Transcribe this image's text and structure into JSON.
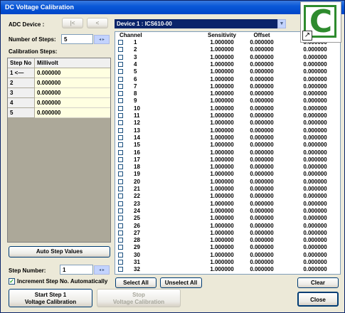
{
  "window": {
    "title": "DC Voltage Calibration"
  },
  "adc": {
    "label": "ADC Device :",
    "first_btn": "|<",
    "prev_btn": "<",
    "device": "Device 1 : ICS610-00"
  },
  "steps": {
    "label": "Number of Steps:",
    "value": "5"
  },
  "calibration": {
    "label": "Calibration Steps:",
    "col_step": "Step No",
    "col_mv": "Millivolt",
    "rows": [
      {
        "step": "1 <—",
        "mv": "0.000000"
      },
      {
        "step": "2",
        "mv": "0.000000"
      },
      {
        "step": "3",
        "mv": "0.000000"
      },
      {
        "step": "4",
        "mv": "0.000000"
      },
      {
        "step": "5",
        "mv": "0.000000"
      }
    ]
  },
  "auto_step": "Auto Step Values",
  "step_number": {
    "label": "Step Number:",
    "value": "1"
  },
  "increment": {
    "label": "Increment Step No. Automatically",
    "checked": true
  },
  "start_btn": {
    "line1": "Start Step 1",
    "line2": "Voltage Calibration"
  },
  "stop_btn": {
    "line1": "Stop",
    "line2": "Voltage Calibration"
  },
  "grid": {
    "col_channel": "Channel",
    "col_sensitivity": "Sensitivity",
    "col_offset": "Offset",
    "rows": [
      {
        "ch": "1",
        "sens": "1.000000",
        "off": "0.000000",
        "gain": "0.000000"
      },
      {
        "ch": "2",
        "sens": "1.000000",
        "off": "0.000000",
        "gain": "0.000000"
      },
      {
        "ch": "3",
        "sens": "1.000000",
        "off": "0.000000",
        "gain": "0.000000"
      },
      {
        "ch": "4",
        "sens": "1.000000",
        "off": "0.000000",
        "gain": "0.000000"
      },
      {
        "ch": "5",
        "sens": "1.000000",
        "off": "0.000000",
        "gain": "0.000000"
      },
      {
        "ch": "6",
        "sens": "1.000000",
        "off": "0.000000",
        "gain": "0.000000"
      },
      {
        "ch": "7",
        "sens": "1.000000",
        "off": "0.000000",
        "gain": "0.000000"
      },
      {
        "ch": "8",
        "sens": "1.000000",
        "off": "0.000000",
        "gain": "0.000000"
      },
      {
        "ch": "9",
        "sens": "1.000000",
        "off": "0.000000",
        "gain": "0.000000"
      },
      {
        "ch": "10",
        "sens": "1.000000",
        "off": "0.000000",
        "gain": "0.000000"
      },
      {
        "ch": "11",
        "sens": "1.000000",
        "off": "0.000000",
        "gain": "0.000000"
      },
      {
        "ch": "12",
        "sens": "1.000000",
        "off": "0.000000",
        "gain": "0.000000"
      },
      {
        "ch": "13",
        "sens": "1.000000",
        "off": "0.000000",
        "gain": "0.000000"
      },
      {
        "ch": "14",
        "sens": "1.000000",
        "off": "0.000000",
        "gain": "0.000000"
      },
      {
        "ch": "15",
        "sens": "1.000000",
        "off": "0.000000",
        "gain": "0.000000"
      },
      {
        "ch": "16",
        "sens": "1.000000",
        "off": "0.000000",
        "gain": "0.000000"
      },
      {
        "ch": "17",
        "sens": "1.000000",
        "off": "0.000000",
        "gain": "0.000000"
      },
      {
        "ch": "18",
        "sens": "1.000000",
        "off": "0.000000",
        "gain": "0.000000"
      },
      {
        "ch": "19",
        "sens": "1.000000",
        "off": "0.000000",
        "gain": "0.000000"
      },
      {
        "ch": "20",
        "sens": "1.000000",
        "off": "0.000000",
        "gain": "0.000000"
      },
      {
        "ch": "21",
        "sens": "1.000000",
        "off": "0.000000",
        "gain": "0.000000"
      },
      {
        "ch": "22",
        "sens": "1.000000",
        "off": "0.000000",
        "gain": "0.000000"
      },
      {
        "ch": "23",
        "sens": "1.000000",
        "off": "0.000000",
        "gain": "0.000000"
      },
      {
        "ch": "24",
        "sens": "1.000000",
        "off": "0.000000",
        "gain": "0.000000"
      },
      {
        "ch": "25",
        "sens": "1.000000",
        "off": "0.000000",
        "gain": "0.000000"
      },
      {
        "ch": "26",
        "sens": "1.000000",
        "off": "0.000000",
        "gain": "0.000000"
      },
      {
        "ch": "27",
        "sens": "1.000000",
        "off": "0.000000",
        "gain": "0.000000"
      },
      {
        "ch": "28",
        "sens": "1.000000",
        "off": "0.000000",
        "gain": "0.000000"
      },
      {
        "ch": "29",
        "sens": "1.000000",
        "off": "0.000000",
        "gain": "0.000000"
      },
      {
        "ch": "30",
        "sens": "1.000000",
        "off": "0.000000",
        "gain": "0.000000"
      },
      {
        "ch": "31",
        "sens": "1.000000",
        "off": "0.000000",
        "gain": "0.000000"
      },
      {
        "ch": "32",
        "sens": "1.000000",
        "off": "0.000000",
        "gain": "0.000000"
      }
    ]
  },
  "select_all": "Select All",
  "unselect_all": "Unselect All",
  "clear": "Clear",
  "close": "Close",
  "logo": {
    "letter": "C",
    "icon": "shortcut-arrow-icon"
  },
  "colors": {
    "selection": "#0a246a",
    "cell_bg": "#ffffe1",
    "logo_green": "#2e8b2e"
  }
}
